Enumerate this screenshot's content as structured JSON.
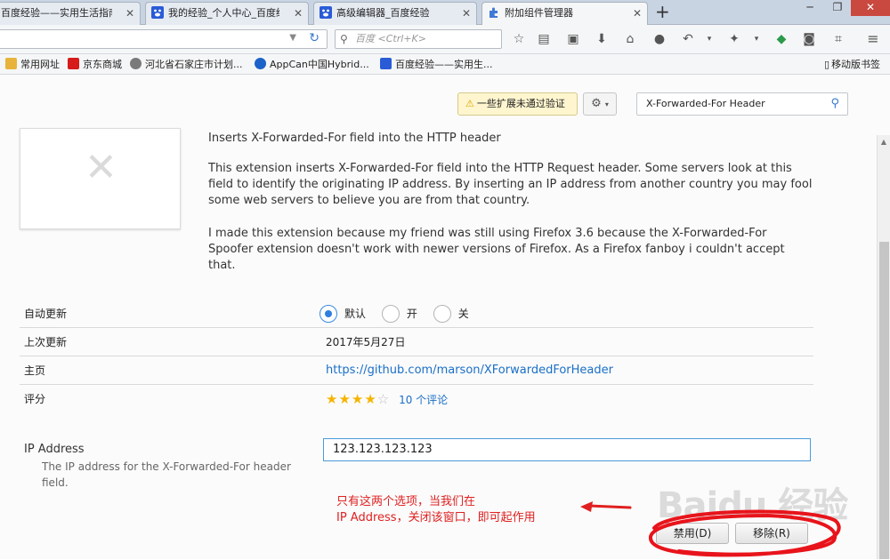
{
  "tabs": [
    {
      "title": "百度经验——实用生活指南",
      "icon_color": "#2a5bd7",
      "active": false
    },
    {
      "title": "我的经验_个人中心_百度经验",
      "icon_color": "#2a5bd7",
      "active": false
    },
    {
      "title": "高级编辑器_百度经验",
      "icon_color": "#2a5bd7",
      "active": false
    },
    {
      "title": "附加组件管理器",
      "icon_color": "#3f7ad6",
      "active": true
    }
  ],
  "window": {
    "new_tab": "+",
    "minimize": "─",
    "restore": "❐",
    "close": "✕"
  },
  "navbar": {
    "search_placeholder": "百度 <Ctrl+K>",
    "icons": [
      "star-icon",
      "reading-list-icon",
      "pocket-icon",
      "download-icon",
      "home-icon",
      "chat-icon",
      "undo-icon",
      "dropdown-icon",
      "extension-icon",
      "dropdown-icon",
      "sync-icon",
      "passenger-icon",
      "crop-icon",
      "menu-icon"
    ]
  },
  "bookmarks": [
    {
      "label": "常用网址",
      "icon_color": "#e8b33a"
    },
    {
      "label": "京东商城",
      "icon_color": "#d71a1a"
    },
    {
      "label": "河北省石家庄市计划...",
      "icon_color": "#7a7a7a"
    },
    {
      "label": "AppCan中国Hybrid...",
      "icon_color": "#1d62c8"
    },
    {
      "label": "百度经验——实用生...",
      "icon_color": "#2a5bd7"
    }
  ],
  "mobile_bookmarks": "移动版书签",
  "toolbar": {
    "warning_label": "一些扩展未通过验证",
    "search_value": "X-Forwarded-For Header"
  },
  "addon": {
    "summary": "Inserts X-Forwarded-For field into the HTTP header",
    "description_1": "This extension inserts X-Forwarded-For field into the HTTP Request header. Some servers look at this field to identify the originating IP address. By inserting an IP address from another country you may fool some web servers to believe you are from that country.",
    "description_2": "I made this extension because my friend was still using Firefox 3.6 because the X-Forwarded-For Spoofer extension doesn't work with newer versions of Firefox. As a Firefox fanboy i couldn't accept that."
  },
  "details": {
    "auto_update_label": "自动更新",
    "auto_update_options": [
      "默认",
      "开",
      "关"
    ],
    "auto_update_selected": "默认",
    "last_updated_label": "上次更新",
    "last_updated_value": "2017年5月27日",
    "homepage_label": "主页",
    "homepage_value": "https://github.com/marson/XForwardedForHeader",
    "rating_label": "评分",
    "rating_value": 4,
    "rating_max": 5,
    "reviews": "10 个评论"
  },
  "preference": {
    "label": "IP Address",
    "help": "The IP address for the X-Forwarded-For header field.",
    "value": "123.123.123.123"
  },
  "annotation": {
    "line1": "只有这两个选项，当我们在",
    "line2": "IP Address，关闭该窗口，即可起作用",
    "color": "#e02020"
  },
  "buttons": {
    "disable": "禁用(D)",
    "remove": "移除(R)"
  },
  "watermark": "Baidu 经验"
}
